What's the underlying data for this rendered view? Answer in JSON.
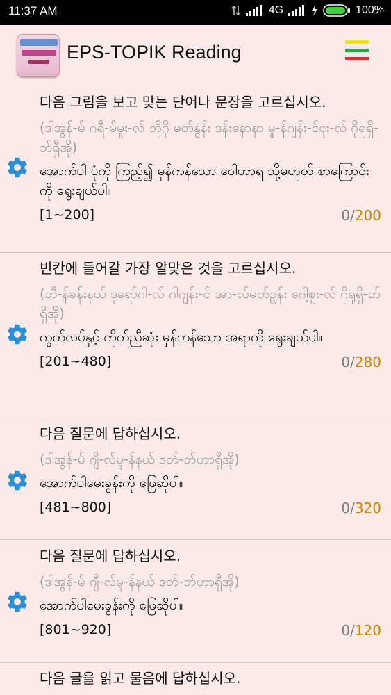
{
  "status_bar": {
    "time": "11:37 AM",
    "network": "4G",
    "battery": "100%"
  },
  "app_bar": {
    "title": "EPS-TOPIK Reading",
    "menu_colors": [
      "#f2e21a",
      "#2fa84a",
      "#e0312d"
    ]
  },
  "sections": [
    {
      "korean": "다음 그림을 보고 맞는 단어나 문장을 고르십시오.",
      "pronunciation": "(ဒါအွန်-မ် ဂရီ-မ်မူး-လ် ဘိုဂို မတ်နွန်း ဒန်းနောနာ မူ-န်ဂျန်း-င်ငူး-လ် ဂိုရုရှိ-ဘ်ရှီအို)",
      "burmese": "အောက်ပါ ပုံကို ကြည့်၍ မှန်ကန်သော ဝေါဟာရ သို့မဟုတ် စာကြောင်းကို ရွေးချယ်ပါ။",
      "range": "[1~200]",
      "done": "0",
      "sep": "/",
      "total": "200"
    },
    {
      "korean": "빈칸에 들어갈 가장 알맞은 것을 고르십시오.",
      "pronunciation": "(ဘီ-န်ခန်းနယ် ဒုရော်ဂါ-လ် ဂါဂျန်း-င် အာ-လ်မတ်ဥ္ဂန်း ဂေါ့စူး-လ် ဂိုရုရှိ-ဘ်ရှီအို)",
      "burmese": "ကွက်လပ်နှင့် ကိုက်ညီဆုံး မှန်ကန်သော အရာကို ရွေးချယ်ပါ။",
      "range": "[201~480]",
      "done": "0",
      "sep": "/",
      "total": "280"
    },
    {
      "korean": "다음 질문에 답하십시오.",
      "pronunciation": "(ဒါအွန်-မ် ဂျီ-လ်မူ-န်နယ် ဒတ်-ဘ်ဟာရှီအို)",
      "burmese": "အောက်ပါမေးခွန်းကို ဖြေဆိုပါ။",
      "range": "[481~800]",
      "done": "0",
      "sep": "/",
      "total": "320"
    },
    {
      "korean": "다음 질문에 답하십시오.",
      "pronunciation": "(ဒါအွန်-မ် ဂျီ-လ်မူ-န်နယ် ဒတ်-ဘ်ဟာရှီအို)",
      "burmese": "အောက်ပါမေးခွန်းကို ဖြေဆိုပါ။",
      "range": "[801~920]",
      "done": "0",
      "sep": "/",
      "total": "120"
    },
    {
      "korean": "다음 글을 읽고 물음에 답하십시오."
    }
  ]
}
